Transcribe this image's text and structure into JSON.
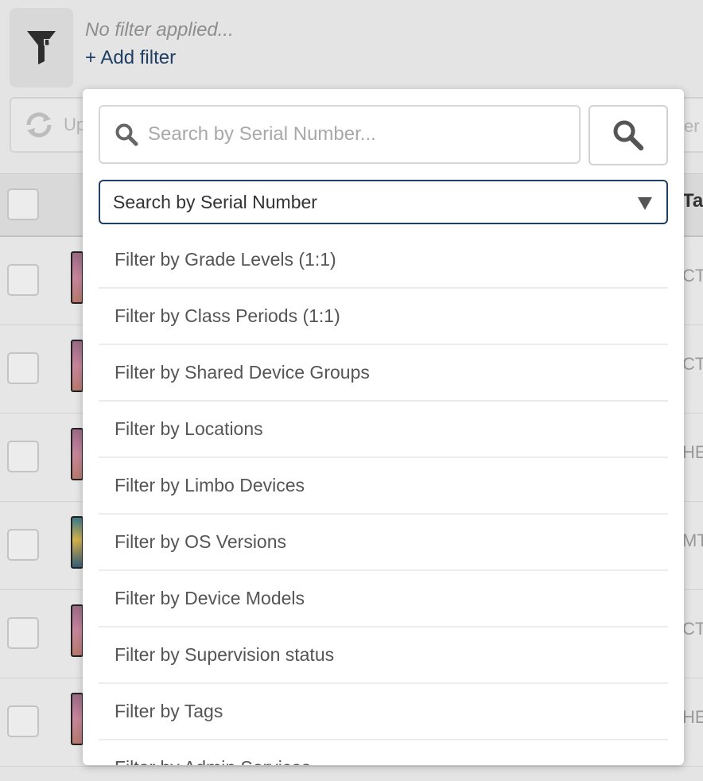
{
  "filter_bar": {
    "status_text": "No filter applied...",
    "add_filter_label": "+ Add filter",
    "icon": "funnel-icon"
  },
  "toolbar": {
    "update_label": "Up",
    "right_label": "er"
  },
  "table": {
    "tags_header": "Tag",
    "rows": [
      {
        "tag": "CTI"
      },
      {
        "tag": "CTI"
      },
      {
        "tag": "HES"
      },
      {
        "tag": "MTI"
      },
      {
        "tag": "CTI"
      },
      {
        "tag": "HES"
      }
    ]
  },
  "popover": {
    "search_placeholder": "Search by Serial Number...",
    "search_value": "",
    "selected_mode": "Search by Serial Number",
    "options": [
      "Filter by Grade Levels (1:1)",
      "Filter by Class Periods (1:1)",
      "Filter by Shared Device Groups",
      "Filter by Locations",
      "Filter by Limbo Devices",
      "Filter by OS Versions",
      "Filter by Device Models",
      "Filter by Supervision status",
      "Filter by Tags",
      "Filter by Admin Services"
    ]
  },
  "colors": {
    "accent": "#1f3f63",
    "muted_text": "#8e8e8e",
    "popover_bg": "#ffffff"
  }
}
